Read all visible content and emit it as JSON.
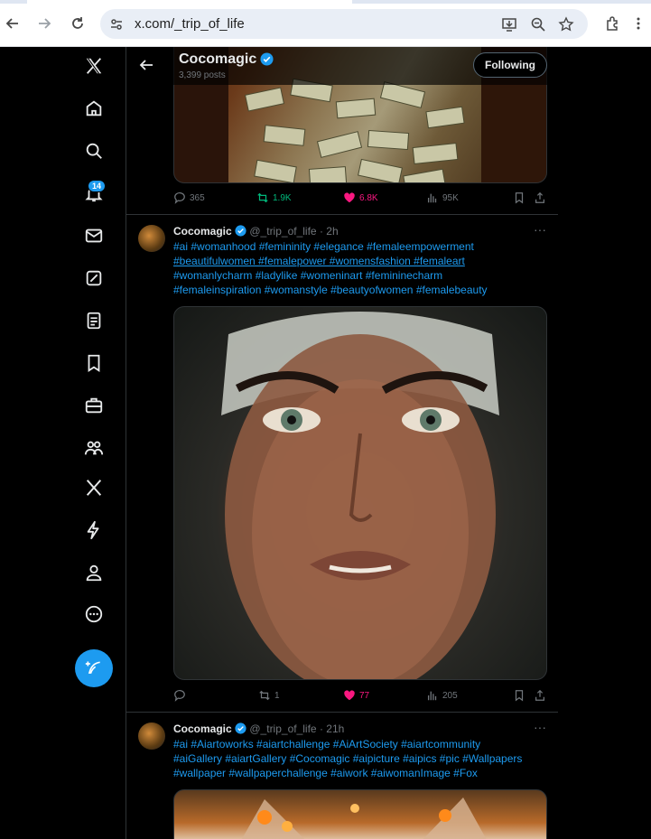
{
  "browser": {
    "url": "x.com/_trip_of_life"
  },
  "profile_header": {
    "name": "Cocomagic",
    "posts_count": "3,399 posts",
    "follow_label": "Following"
  },
  "rail": {
    "notification_badge": "14"
  },
  "tweet0": {
    "replies": "365",
    "reposts": "1.9K",
    "likes": "6.8K",
    "views": "95K"
  },
  "tweet1": {
    "display_name": "Cocomagic",
    "handle": "@_trip_of_life",
    "time": "· 2h",
    "text_line1": "#ai #womanhood #femininity #elegance #femaleempowerment",
    "text_line2": "#beautifulwomen #femalepower #womensfashion #femaleart",
    "text_line3": "#womanlycharm #ladylike #womeninart #femininecharm",
    "text_line4": "#femaleinspiration #womanstyle #beautyofwomen #femalebeauty",
    "replies": "",
    "reposts": "1",
    "likes": "77",
    "views": "205"
  },
  "tweet2": {
    "display_name": "Cocomagic",
    "handle": "@_trip_of_life",
    "time": "· 21h",
    "text_line1": "#ai #Aiartoworks #aiartchallenge #AiArtSociety #aiartcommunity",
    "text_line2": "#aiGallery #aiartGallery #Cocomagic #aipicture #aipics #pic #Wallpapers",
    "text_line3": "#wallpaper #wallpaperchallenge #aiwork #aiwomanImage #Fox"
  },
  "colors": {
    "accent": "#1d9bf0",
    "like": "#f91880",
    "repost": "#00ba7c",
    "muted": "#71767b",
    "border": "#2f3336"
  }
}
